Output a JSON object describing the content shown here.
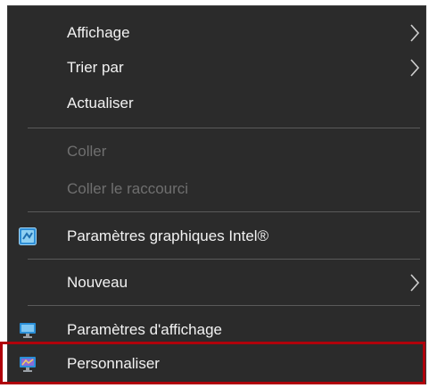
{
  "menu": {
    "items": {
      "affichage": {
        "label": "Affichage"
      },
      "trier_par": {
        "label": "Trier par"
      },
      "actualiser": {
        "label": "Actualiser"
      },
      "coller": {
        "label": "Coller"
      },
      "coller_raccourci": {
        "label": "Coller le raccourci"
      },
      "intel": {
        "label": "Paramètres graphiques Intel®",
        "icon": "intel-graphics-icon"
      },
      "nouveau": {
        "label": "Nouveau"
      },
      "parametres_affichage": {
        "label": "Paramètres d'affichage",
        "icon": "display-settings-icon"
      },
      "personnaliser": {
        "label": "Personnaliser",
        "icon": "personalize-icon"
      }
    },
    "submenu_icon": "chevron-right-icon",
    "highlight_color": "#b0000b",
    "background_color": "#2b2b2b",
    "text_color": "#f2f2f2",
    "disabled_text_color": "#6f6f6f"
  }
}
